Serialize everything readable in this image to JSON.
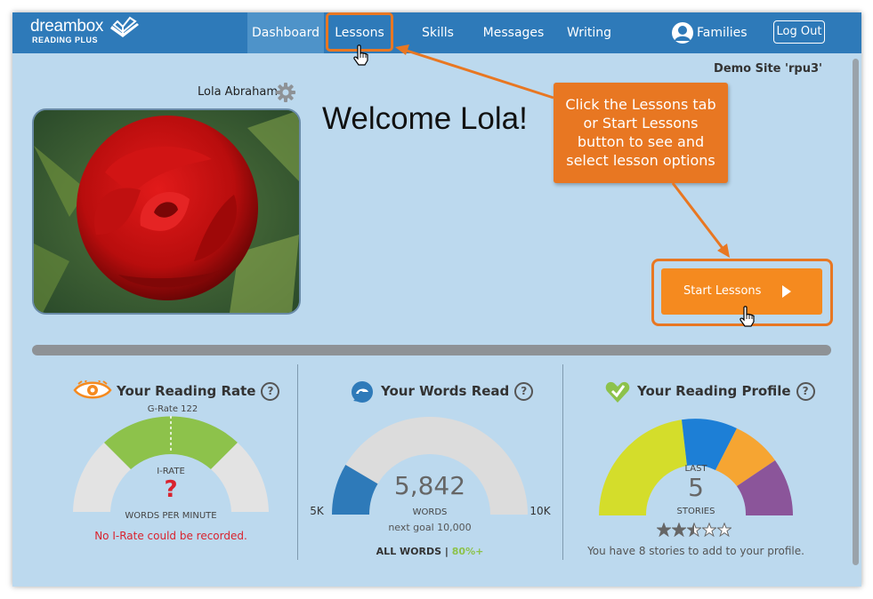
{
  "nav": {
    "logo_line1": "dreambox",
    "logo_line2": "READING PLUS",
    "items": [
      {
        "label": "Dashboard"
      },
      {
        "label": "Lessons"
      },
      {
        "label": "Skills"
      },
      {
        "label": "Messages"
      },
      {
        "label": "Writing"
      },
      {
        "label": "Families"
      }
    ],
    "logout_label": "Log Out"
  },
  "site_label": "Demo Site 'rpu3'",
  "student": {
    "name": "Lola Abraham",
    "welcome": "Welcome Lola!"
  },
  "callout": {
    "lines": [
      "Click the Lessons tab",
      "or Start Lessons",
      "button to see and",
      "select lesson options"
    ]
  },
  "start_button": {
    "label": "Start Lessons"
  },
  "panels": {
    "rate": {
      "title": "Your Reading Rate",
      "grate": "G-Rate 122",
      "irate_label": "I-RATE",
      "irate_value": "?",
      "unit": "WORDS PER MINUTE",
      "note": "No I-Rate could be recorded."
    },
    "words": {
      "title": "Your Words Read",
      "value": "5,842",
      "unit": "WORDS",
      "next_goal": "next goal 10,000",
      "min_label": "5K",
      "max_label": "10K",
      "footer_label": "ALL WORDS",
      "footer_sep": "|",
      "footer_pct": "80%+",
      "progress": 0.17
    },
    "profile": {
      "title": "Your Reading Profile",
      "last_label": "LAST",
      "count": "5",
      "unit": "STORIES",
      "rating": 2.5,
      "rating_max": 5,
      "note": "You have 8 stories to add to your profile."
    }
  },
  "colors": {
    "nav": "#2e7ab9",
    "background": "#bcd9ee",
    "accent": "#e87722",
    "green": "#8dc24b",
    "error": "#d9232e",
    "profile_segments": [
      "#d4dd2b",
      "#1d7fd6",
      "#f6a532",
      "#8b559a"
    ]
  }
}
